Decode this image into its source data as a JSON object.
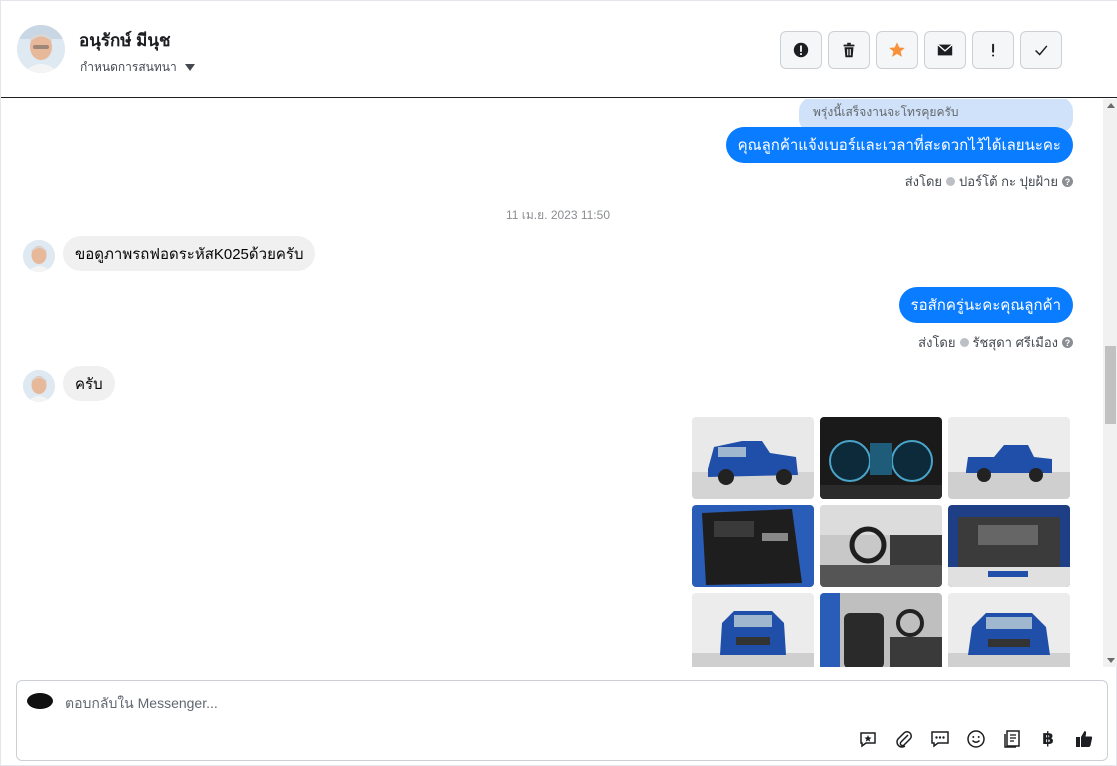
{
  "header": {
    "contact_name": "อนุรักษ์ มีนุช",
    "assign_label": "กำหนดการสนทนา",
    "toolbar": [
      {
        "icon": "alert-circle-icon",
        "label": "Mark as spam"
      },
      {
        "icon": "trash-icon",
        "label": "Delete"
      },
      {
        "icon": "star-icon",
        "label": "Star"
      },
      {
        "icon": "mail-icon",
        "label": "Mark as unread"
      },
      {
        "icon": "exclamation-icon",
        "label": "Follow up"
      },
      {
        "icon": "check-icon",
        "label": "Done"
      }
    ]
  },
  "conversation": {
    "reply_quote": "พรุ่งนี้เสร็จงานจะโทรคุยครับ",
    "messages": [
      {
        "direction": "out",
        "text": "คุณลูกค้าแจ้งเบอร์และเวลาที่สะดวกไว้ได้เลยนะคะ",
        "sent_by_prefix": "ส่งโดย",
        "sent_by_name": "ปอร์โต้ กะ ปุยฝ้าย"
      },
      {
        "direction": "in",
        "text": "ขอดูภาพรถฟอดระหัสK025ด้วยครับ"
      },
      {
        "direction": "out",
        "text": "รอสักครู่นะคะคุณลูกค้า",
        "sent_by_prefix": "ส่งโดย",
        "sent_by_name": "รัชสุดา ศรีเมือง"
      },
      {
        "direction": "in",
        "text": "ครับ"
      }
    ],
    "timestamp": "11 เม.ย. 2023 11:50",
    "photos": [
      {
        "subject": "blue pickup front three-quarter"
      },
      {
        "subject": "instrument cluster"
      },
      {
        "subject": "blue pickup side"
      },
      {
        "subject": "door interior panel"
      },
      {
        "subject": "dashboard interior"
      },
      {
        "subject": "engine bay"
      },
      {
        "subject": "blue pickup front"
      },
      {
        "subject": "front seats interior"
      },
      {
        "subject": "blue pickup front angle"
      }
    ]
  },
  "composer": {
    "placeholder": "ตอบกลับใน Messenger...",
    "currency_symbol": "฿",
    "tools": [
      "saved-reply-icon",
      "attachment-icon",
      "chat-bubbles-icon",
      "emoji-icon",
      "notes-icon",
      "baht-icon",
      "thumbs-up-icon"
    ]
  },
  "colors": {
    "outgoing_bubble": "#0a7cff",
    "incoming_bubble": "#f0f0f0",
    "reply_quote": "#cfe2fa",
    "star": "#f7923a",
    "car_blue": "#1f4fa8"
  }
}
